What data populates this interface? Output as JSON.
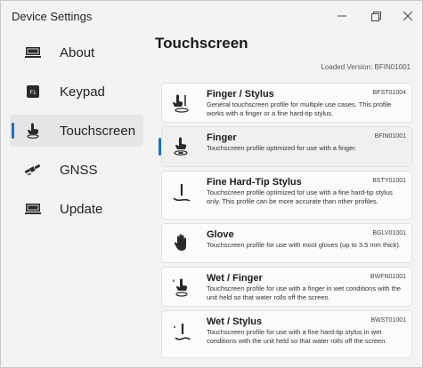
{
  "window": {
    "title": "Device Settings",
    "minimize_icon": "minimize-icon",
    "maximize_icon": "restore-icon",
    "close_icon": "close-icon"
  },
  "sidebar": {
    "items": [
      {
        "label": "About",
        "icon": "monitor-icon"
      },
      {
        "label": "Keypad",
        "icon": "keypad-icon"
      },
      {
        "label": "Touchscreen",
        "icon": "touch-hand-icon",
        "active": true
      },
      {
        "label": "GNSS",
        "icon": "satellite-icon"
      },
      {
        "label": "Update",
        "icon": "monitor-icon"
      }
    ]
  },
  "main": {
    "title": "Touchscreen",
    "loaded_version": "Loaded Version: BFIN01001",
    "profiles": [
      {
        "name": "Finger / Stylus",
        "code": "BFST01004",
        "desc": "General touchscreen profile for multiple use cases. This profile works with a finger or a fine hard-tip stylus.",
        "icon": "finger-stylus-icon"
      },
      {
        "name": "Finger",
        "code": "BFIN01001",
        "desc": "Touchscreen profile optimized for use with a finger.",
        "icon": "finger-touch-icon",
        "active": true
      },
      {
        "name": "Fine Hard-Tip Stylus",
        "code": "BSTY01001",
        "desc": "Touchscreen profile optimized for use with a fine hard-tip stylus only. This profile can be more accurate than other profiles.",
        "icon": "stylus-icon"
      },
      {
        "name": "Glove",
        "code": "BGLV01001",
        "desc": "Touchscreen profile for use with most gloves (up to 3.5 mm thick).",
        "icon": "glove-icon"
      },
      {
        "name": "Wet / Finger",
        "code": "BWFN01001",
        "desc": "Touchscreen profile for use with a finger in wet conditions with the unit held so that water rolls off the screen.",
        "icon": "wet-finger-icon"
      },
      {
        "name": "Wet / Stylus",
        "code": "BWST01001",
        "desc": "Touchscreen profile for use with a fine hard-tip stylus in wet conditions with the unit held so that water rolls off the screen.",
        "icon": "wet-stylus-icon"
      }
    ]
  },
  "colors": {
    "accent": "#1a6fc4",
    "background": "#f3f3f3",
    "card": "#fbfbfb",
    "active_card": "#f0f0f0"
  }
}
